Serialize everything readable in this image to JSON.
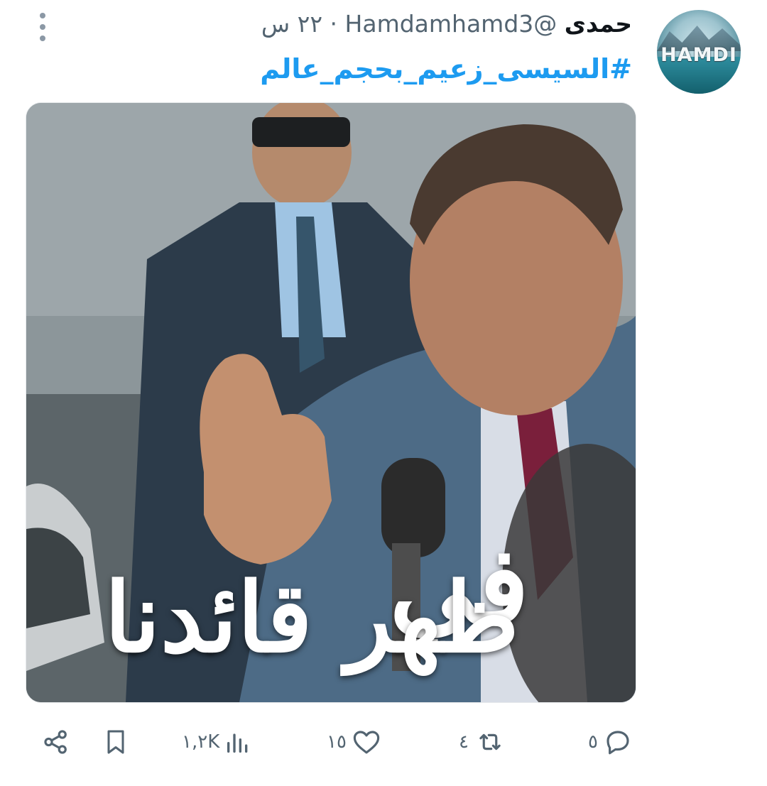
{
  "tweet": {
    "display_name": "حمدى",
    "handle": "@Hamdamhamd3",
    "separator": "·",
    "time": "٢٢ س",
    "hashtag": "#السيسى_زعيم_بحجم_عالم",
    "avatar_text": "HAMDI"
  },
  "media": {
    "overlay_line_1": "في",
    "overlay_line_2": "ظهر قائدنا"
  },
  "actions": {
    "reply_count": "٥",
    "retweet_count": "٤",
    "like_count": "١٥",
    "views_count": "١,٢K"
  },
  "colors": {
    "link": "#1d9bf0",
    "secondary_text": "#536471",
    "icon": "#536471"
  },
  "icons": [
    "more-vertical-icon",
    "reply-icon",
    "retweet-icon",
    "like-icon",
    "views-icon",
    "bookmark-icon",
    "share-icon"
  ]
}
